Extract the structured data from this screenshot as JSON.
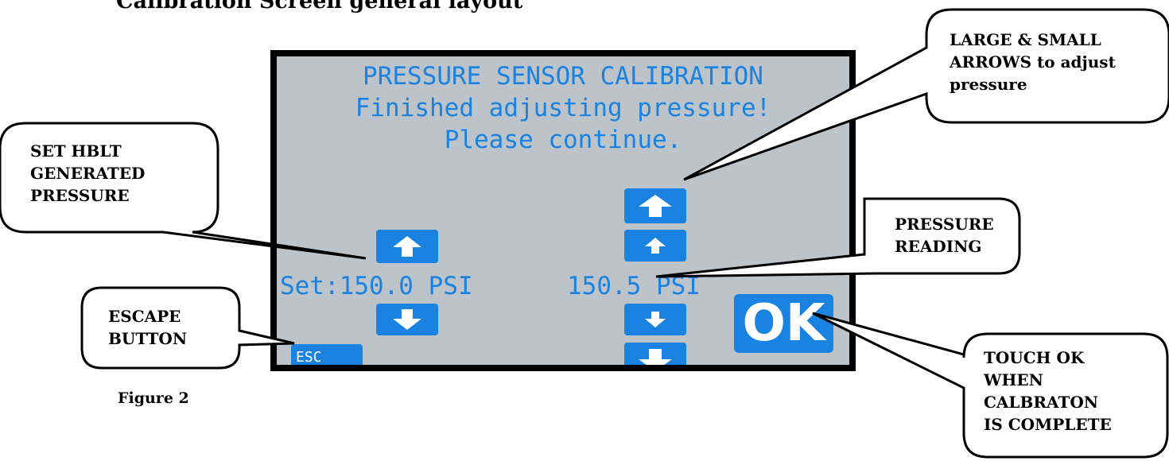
{
  "page": {
    "heading": "Calibration Screen general layout",
    "figure_caption": "Figure 2"
  },
  "screen": {
    "title_line1": "PRESSURE SENSOR CALIBRATION",
    "title_line2": "Finished adjusting pressure!",
    "title_line3": "Please continue.",
    "set_pressure": "Set:150.0 PSI",
    "pressure_reading": "150.5 PSI",
    "esc_label": "ESC",
    "ok_label": "OK"
  },
  "callouts": {
    "arrows_line1": "LARGE & SMALL",
    "arrows_line2": "ARROWS to adjust",
    "arrows_line3": "pressure",
    "set_line1": "SET HBLT",
    "set_line2": "GENERATED",
    "set_line3": "PRESSURE",
    "reading_line1": "PRESSURE",
    "reading_line2": "READING",
    "escape_line1": "ESCAPE",
    "escape_line2": "BUTTON",
    "ok_line1": "TOUCH OK",
    "ok_line2": "WHEN",
    "ok_line3": "CALBRATON",
    "ok_line4": "IS COMPLETE"
  },
  "colors": {
    "lcd_background": "#bcc3c9",
    "accent": "#1a82e0",
    "border": "#000000"
  }
}
